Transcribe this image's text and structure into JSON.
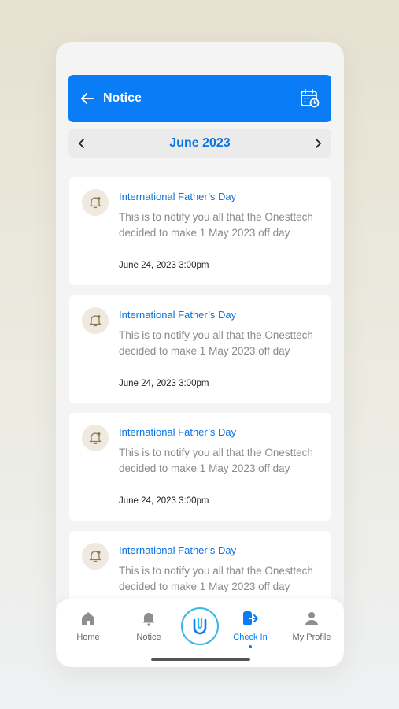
{
  "header": {
    "title": "Notice",
    "back_icon": "arrow-left-icon",
    "calendar_icon": "calendar-clock-icon"
  },
  "month_bar": {
    "label": "June 2023",
    "prev_icon": "chevron-left-icon",
    "next_icon": "chevron-right-icon"
  },
  "notices": [
    {
      "title": "International Father’s Day",
      "body": "This is to notify you all that the Onesttech decided to make 1 May 2023 off day",
      "date": "June 24, 2023 3:00pm"
    },
    {
      "title": "International Father’s Day",
      "body": "This is to notify you all that the Onesttech decided to make 1 May 2023 off day",
      "date": "June 24, 2023 3:00pm"
    },
    {
      "title": "International Father’s Day",
      "body": "This is to notify you all that the Onesttech decided to make 1 May 2023 off day",
      "date": "June 24, 2023 3:00pm"
    },
    {
      "title": "International Father’s Day",
      "body": "This is to notify you all that the Onesttech decided to make 1 May 2023 off day",
      "date": ""
    }
  ],
  "tabbar": {
    "home": "Home",
    "notice": "Notice",
    "checkin": "Check In",
    "profile": "My Profile"
  },
  "colors": {
    "primary": "#0a7cf5",
    "title_blue": "#0a74e0",
    "icon_bg": "#efe9df",
    "center_ring": "#38b6e8"
  }
}
